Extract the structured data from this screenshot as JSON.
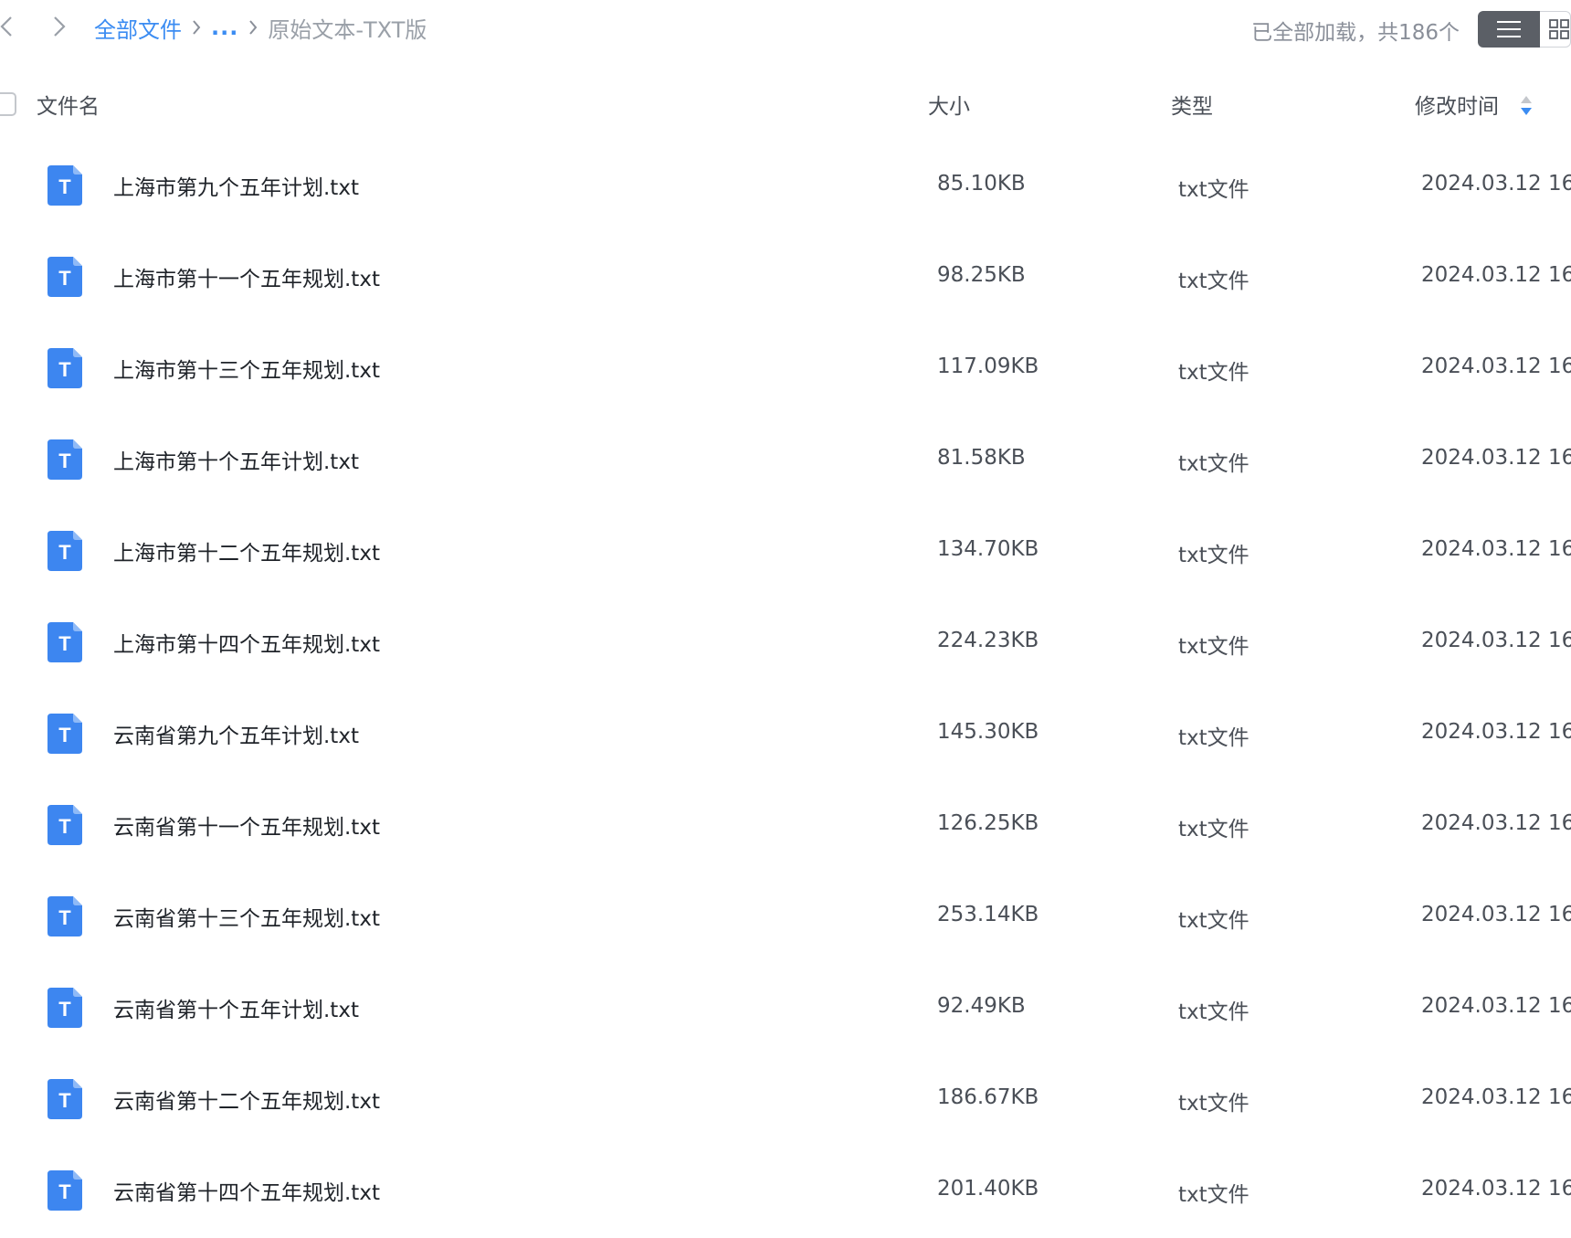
{
  "breadcrumb": {
    "root": "全部文件",
    "ellipsis": "...",
    "current": "原始文本-TXT版"
  },
  "status": "已全部加载，共186个",
  "columns": {
    "name": "文件名",
    "size": "大小",
    "type": "类型",
    "modified": "修改时间"
  },
  "files": [
    {
      "name": "上海市第九个五年计划.txt",
      "size": "85.10KB",
      "type": "txt文件",
      "modified": "2024.03.12 16:"
    },
    {
      "name": "上海市第十一个五年规划.txt",
      "size": "98.25KB",
      "type": "txt文件",
      "modified": "2024.03.12 16:"
    },
    {
      "name": "上海市第十三个五年规划.txt",
      "size": "117.09KB",
      "type": "txt文件",
      "modified": "2024.03.12 16:"
    },
    {
      "name": "上海市第十个五年计划.txt",
      "size": "81.58KB",
      "type": "txt文件",
      "modified": "2024.03.12 16:"
    },
    {
      "name": "上海市第十二个五年规划.txt",
      "size": "134.70KB",
      "type": "txt文件",
      "modified": "2024.03.12 16:"
    },
    {
      "name": "上海市第十四个五年规划.txt",
      "size": "224.23KB",
      "type": "txt文件",
      "modified": "2024.03.12 16:"
    },
    {
      "name": "云南省第九个五年计划.txt",
      "size": "145.30KB",
      "type": "txt文件",
      "modified": "2024.03.12 16:"
    },
    {
      "name": "云南省第十一个五年规划.txt",
      "size": "126.25KB",
      "type": "txt文件",
      "modified": "2024.03.12 16:"
    },
    {
      "name": "云南省第十三个五年规划.txt",
      "size": "253.14KB",
      "type": "txt文件",
      "modified": "2024.03.12 16:"
    },
    {
      "name": "云南省第十个五年计划.txt",
      "size": "92.49KB",
      "type": "txt文件",
      "modified": "2024.03.12 16:"
    },
    {
      "name": "云南省第十二个五年规划.txt",
      "size": "186.67KB",
      "type": "txt文件",
      "modified": "2024.03.12 16:"
    },
    {
      "name": "云南省第十四个五年规划.txt",
      "size": "201.40KB",
      "type": "txt文件",
      "modified": "2024.03.12 16:"
    }
  ],
  "file_icon": {
    "name": "txt-file-icon",
    "letter": "T",
    "color": "#3d86f0"
  },
  "colors": {
    "accent": "#3b8cf2",
    "muted": "#8a8f99",
    "list_button_bg": "#5b5f66"
  }
}
